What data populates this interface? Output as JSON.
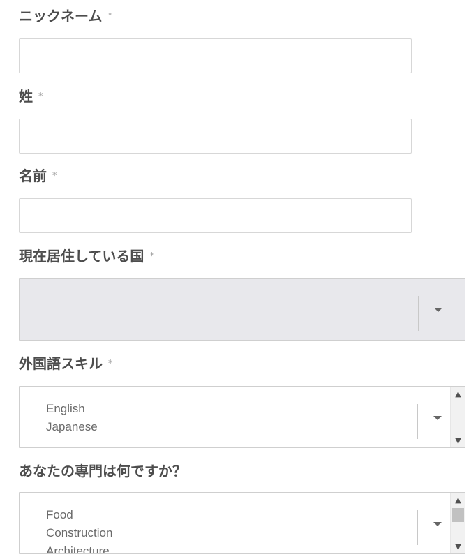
{
  "form": {
    "nickname": {
      "label": "ニックネーム",
      "required_mark": "*",
      "value": ""
    },
    "last_name": {
      "label": "姓",
      "required_mark": "*",
      "value": ""
    },
    "first_name": {
      "label": "名前",
      "required_mark": "*",
      "value": ""
    },
    "country": {
      "label": "現在居住している国",
      "required_mark": "*",
      "value": "",
      "disabled": true
    },
    "language_skill": {
      "label": "外国語スキル",
      "required_mark": "*",
      "options": [
        "English",
        "Japanese"
      ]
    },
    "specialty": {
      "label": "あなたの専門は何ですか？",
      "options": [
        "Food",
        "Construction",
        "Architecture"
      ]
    }
  },
  "icons": {
    "caret": "chevron-down-icon",
    "scroll_up": "scroll-up-arrow-icon",
    "scroll_down": "scroll-down-arrow-icon"
  },
  "colors": {
    "label": "#4d4d4d",
    "required": "#a0a0a0",
    "border": "#d7d7d7",
    "disabled_bg": "#e8e8ec"
  }
}
